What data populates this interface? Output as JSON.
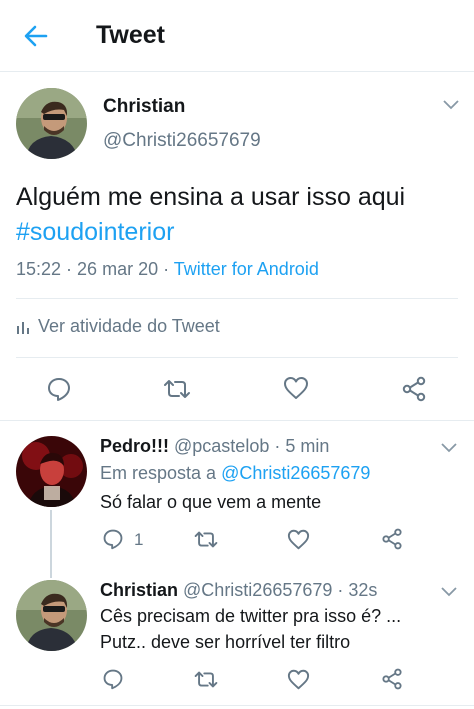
{
  "header": {
    "title": "Tweet",
    "back_icon": "arrow-left-icon"
  },
  "main_tweet": {
    "author_name": "Christian",
    "author_handle": "@Christi26657679",
    "text_plain": "Alguém me ensina a usar isso aqui ",
    "hashtag": "#soudointerior",
    "time": "15:22",
    "date": "26 mar 20",
    "source": "Twitter for Android",
    "separator": " · ",
    "activity_label": "Ver atividade do Tweet"
  },
  "replies": [
    {
      "author_name": "Pedro!!!",
      "author_handle": "@pcastelob",
      "time_ago": "5 min",
      "reply_prefix": "Em resposta a",
      "reply_to": "@Christi26657679",
      "text": "Só falar o que vem a mente",
      "reply_count": "1"
    },
    {
      "author_name": "Christian",
      "author_handle": "@Christi26657679",
      "time_ago": "32s",
      "text_line1": "Cês precisam de twitter pra isso é? ...",
      "text_line2": "Putz.. deve ser horrível ter filtro"
    }
  ],
  "colors": {
    "accent": "#1da1f2",
    "muted": "#657786",
    "text": "#14171a",
    "divider": "#e6ecf0"
  }
}
